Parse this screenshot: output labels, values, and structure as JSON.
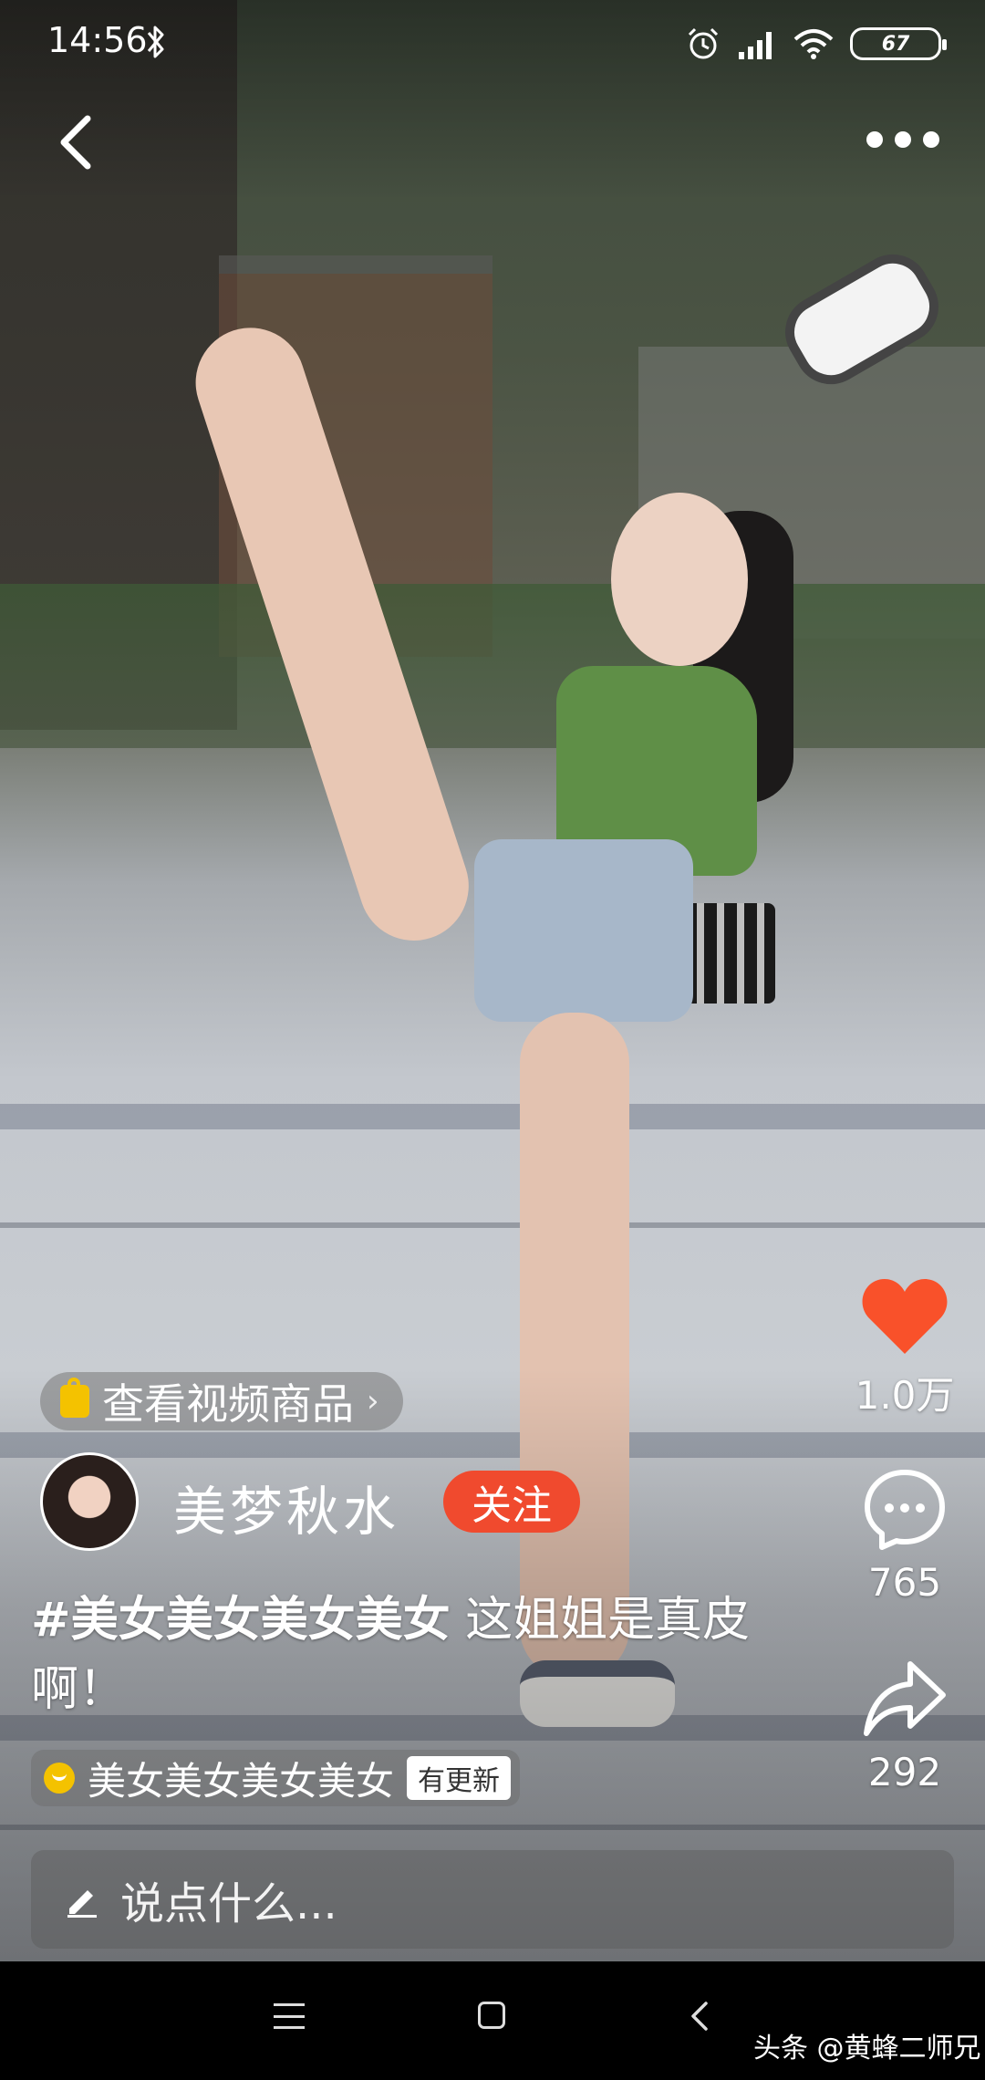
{
  "status_bar": {
    "time": "14:56",
    "battery": "67",
    "icons": [
      "bluetooth-icon",
      "alarm-icon",
      "signal-icon",
      "wifi-icon",
      "battery-icon"
    ]
  },
  "top_nav": {
    "back_icon": "chevron-left-icon",
    "more_icon": "more-dots-icon"
  },
  "actions": {
    "like_count": "1.0万",
    "comment_count": "765",
    "share_count": "292",
    "like_color": "#f9512a"
  },
  "product": {
    "label": "查看视频商品",
    "arrow": "›"
  },
  "author": {
    "name": "美梦秋水",
    "follow_label": "关注",
    "follow_color": "#f04a2e"
  },
  "caption": {
    "hashtag": "#美女美女美女美女",
    "text": " 这姐姐是真皮啊！"
  },
  "collection": {
    "name": "美女美女美女美女",
    "badge": "有更新"
  },
  "comment_input": {
    "placeholder": "说点什么..."
  },
  "watermark": {
    "text": "头条 @黄蜂二师兄"
  }
}
